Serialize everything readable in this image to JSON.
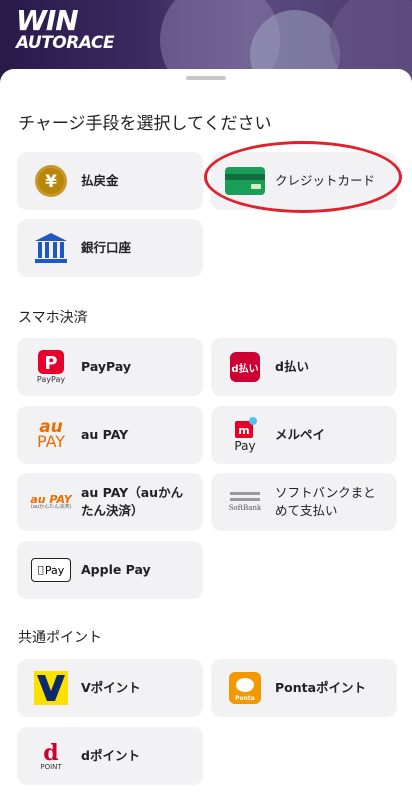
{
  "header": {
    "logo_line1": "WIN",
    "logo_line2": "AUTORACE"
  },
  "sheet": {
    "title": "チャージ手段を選択してください"
  },
  "charge_methods": [
    {
      "label": "払戻金",
      "icon": "yen-coin-icon"
    },
    {
      "label": "クレジットカード",
      "icon": "credit-card-icon"
    },
    {
      "label": "銀行口座",
      "icon": "bank-icon"
    }
  ],
  "sections": {
    "smartphone": "スマホ決済",
    "points": "共通ポイント"
  },
  "smartphone_methods": [
    {
      "label": "PayPay",
      "icon": "paypay-icon",
      "icon_text": "PayPay"
    },
    {
      "label": "d払い",
      "icon": "d-barai-icon",
      "icon_text": "d払い"
    },
    {
      "label": "au PAY",
      "icon": "au-pay-icon",
      "icon_text_top": "au",
      "icon_text_bottom": "PAY"
    },
    {
      "label": "メルペイ",
      "icon": "merpay-icon",
      "icon_text": "Pay"
    },
    {
      "label": "au PAY（auかんたん決済）",
      "icon": "au-pay-kantan-icon",
      "icon_text_top": "au PAY",
      "icon_text_bottom": "(auかんたん決済)"
    },
    {
      "label": "ソフトバンクまとめて支払い",
      "icon": "softbank-icon",
      "icon_text": "SoftBank"
    },
    {
      "label": "Apple Pay",
      "icon": "apple-pay-icon",
      "icon_text": "Pay"
    }
  ],
  "point_methods": [
    {
      "label": "Vポイント",
      "icon": "v-point-icon"
    },
    {
      "label": "Pontaポイント",
      "icon": "ponta-icon",
      "icon_text": "Ponta"
    },
    {
      "label": "dポイント",
      "icon": "d-point-icon",
      "icon_text": "POINT"
    }
  ],
  "colors": {
    "tile_bg": "#f2f2f4",
    "annotation": "#e0202a",
    "yen_gold": "#b8860b",
    "card_green": "#1a9e5a",
    "bank_blue": "#1f56c8",
    "paypay_red": "#e8002d",
    "docomo_red": "#cc0033",
    "au_orange": "#ec6c00",
    "ponta_orange": "#f39800",
    "v_yellow": "#fce100",
    "v_navy": "#0b2a6b"
  }
}
